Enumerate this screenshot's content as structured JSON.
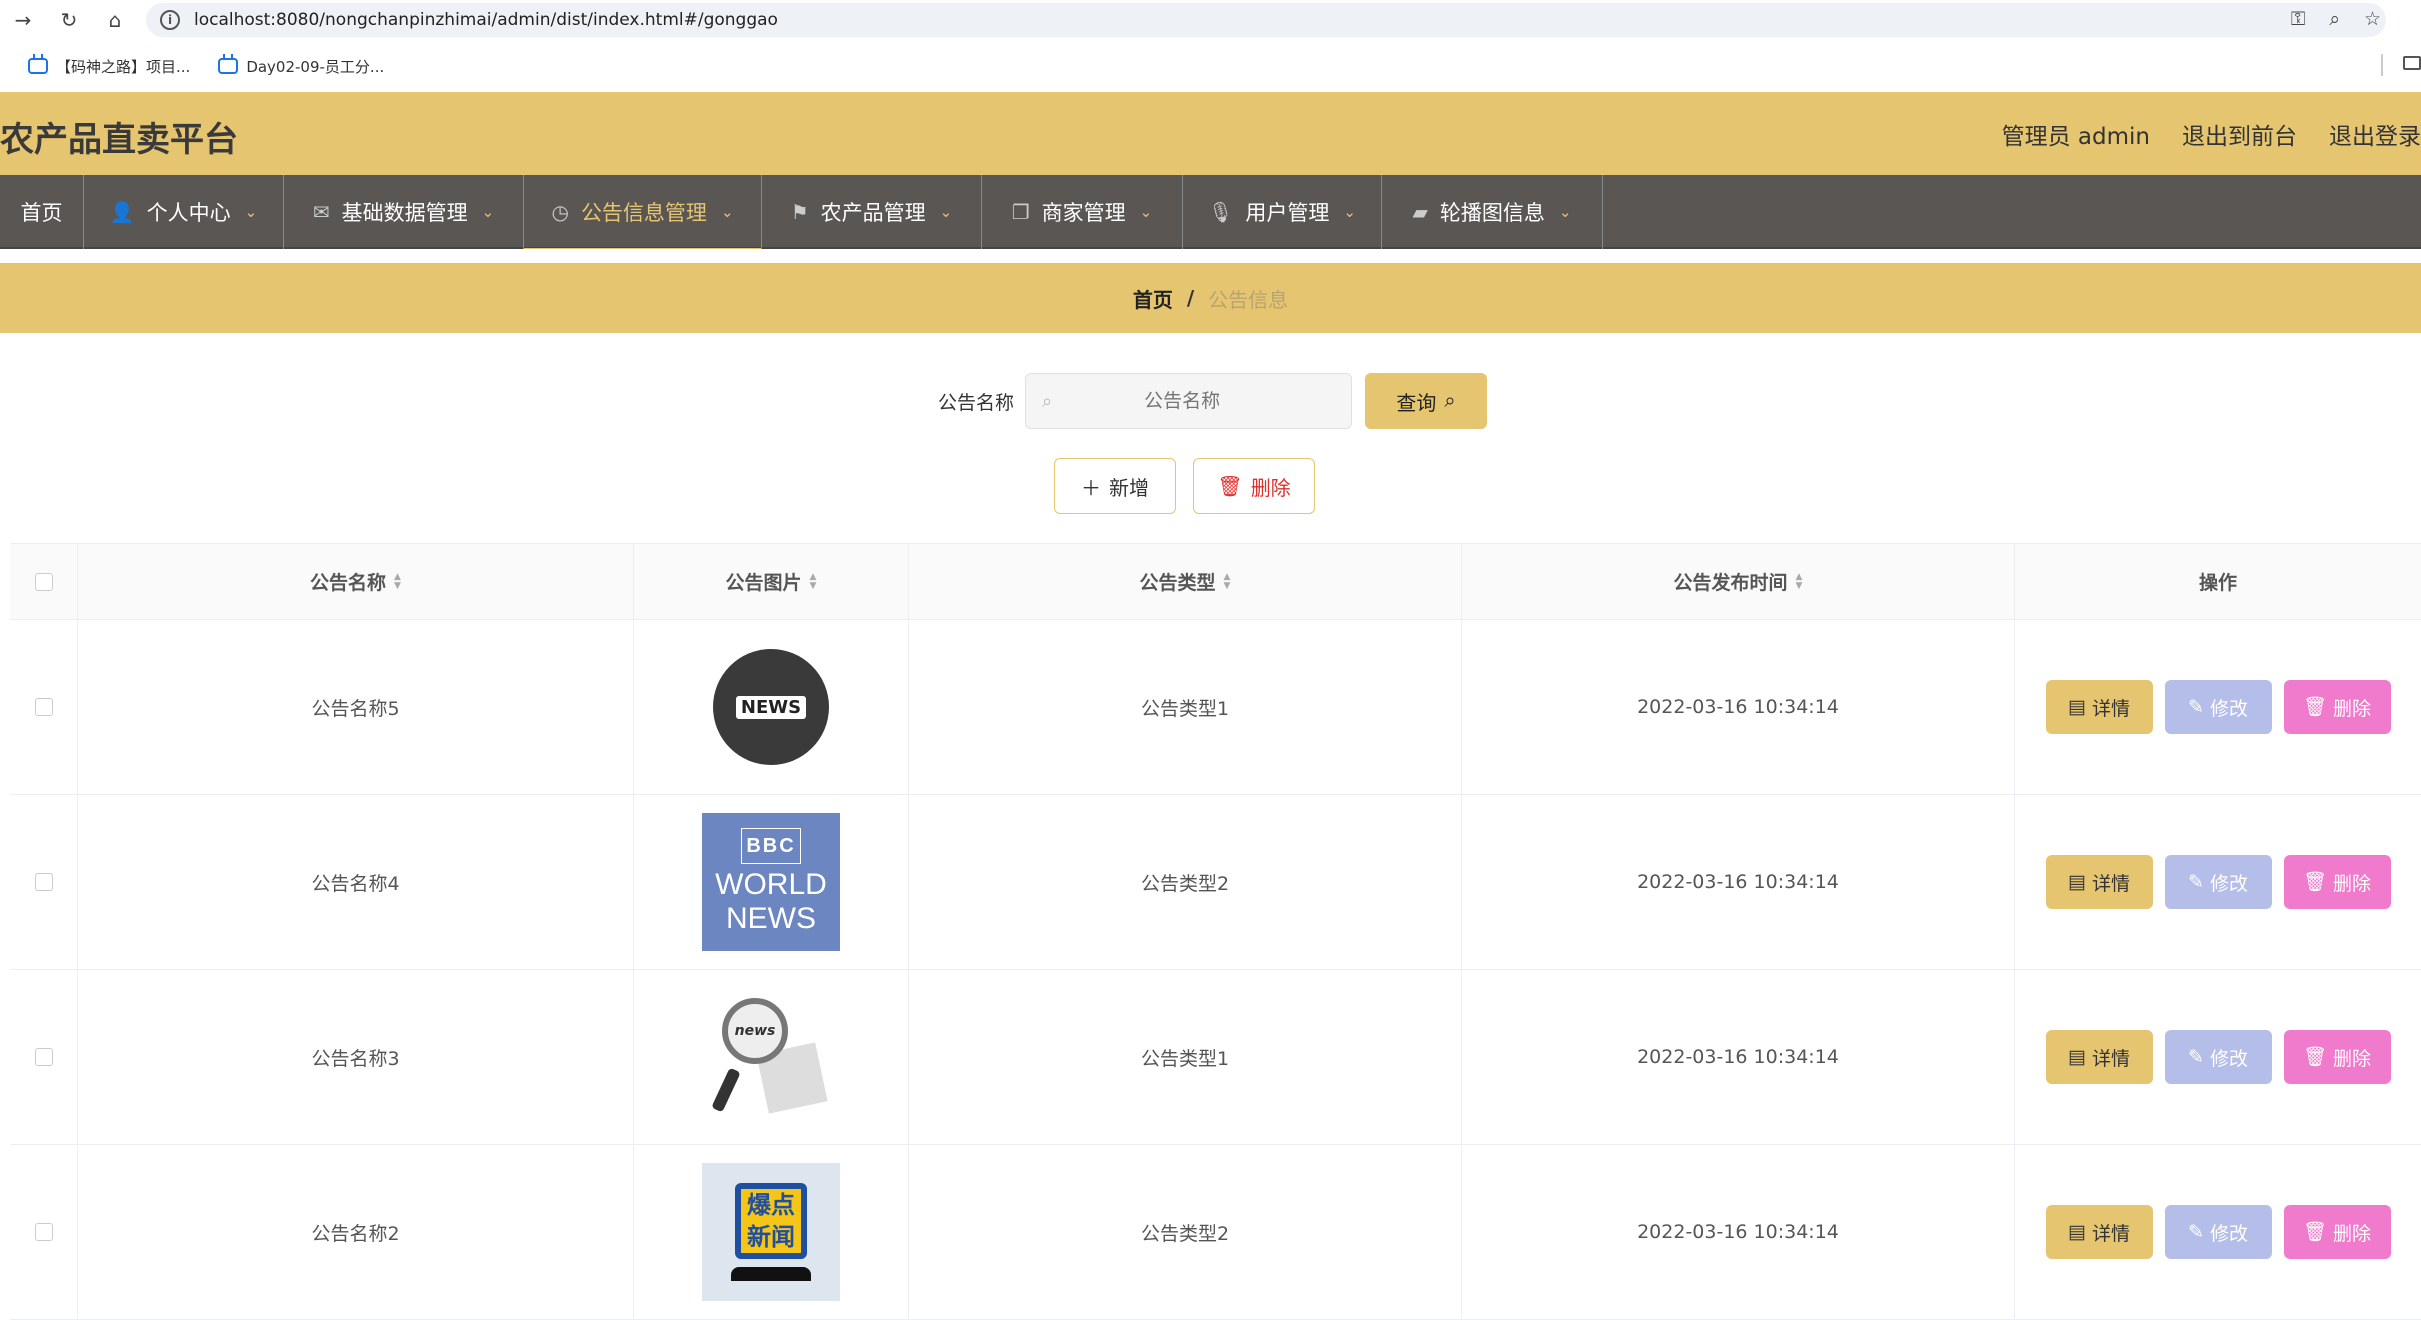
{
  "browser": {
    "url": "localhost:8080/nongchanpinzhimai/admin/dist/index.html#/gonggao",
    "bookmarks": [
      "【码神之路】项目...",
      "Day02-09-员工分..."
    ]
  },
  "header": {
    "title": "农产品直卖平台",
    "user_label": "管理员 admin",
    "to_front_label": "退出到前台",
    "logout_label": "退出登录"
  },
  "nav": {
    "items": [
      {
        "label": "首页",
        "icon": "home-icon"
      },
      {
        "label": "个人中心",
        "icon": "user-icon"
      },
      {
        "label": "基础数据管理",
        "icon": "mail-icon"
      },
      {
        "label": "公告信息管理",
        "icon": "clock-icon"
      },
      {
        "label": "农产品管理",
        "icon": "flag-icon"
      },
      {
        "label": "商家管理",
        "icon": "copy-icon"
      },
      {
        "label": "用户管理",
        "icon": "mic-icon"
      },
      {
        "label": "轮播图信息",
        "icon": "chat-icon"
      }
    ],
    "active_index": 3
  },
  "breadcrumb": {
    "home": "首页",
    "separator": "/",
    "current": "公告信息"
  },
  "search": {
    "label": "公告名称",
    "placeholder": "公告名称",
    "query_label": "查询"
  },
  "actions": {
    "add_label": "新增",
    "delete_label": "删除"
  },
  "table": {
    "columns": [
      "公告名称",
      "公告图片",
      "公告类型",
      "公告发布时间",
      "操作"
    ],
    "rows": [
      {
        "name": "公告名称5",
        "image": "news-globe",
        "type": "公告类型1",
        "time": "2022-03-16 10:34:14"
      },
      {
        "name": "公告名称4",
        "image": "bbc-world-news",
        "type": "公告类型2",
        "time": "2022-03-16 10:34:14"
      },
      {
        "name": "公告名称3",
        "image": "news-magnifier",
        "type": "公告类型1",
        "time": "2022-03-16 10:34:14"
      },
      {
        "name": "公告名称2",
        "image": "baodian-news",
        "type": "公告类型2",
        "time": "2022-03-16 10:34:14"
      }
    ],
    "op_labels": {
      "detail": "详情",
      "edit": "修改",
      "delete": "删除"
    }
  },
  "thumb_text": {
    "news": "NEWS",
    "bbc": "BBC",
    "world": "WORLD",
    "news2": "NEWS",
    "mag": "news",
    "burst1": "爆点",
    "burst2": "新闻"
  },
  "colors": {
    "accent": "#e5c570",
    "nav_bg": "#5a5654",
    "edit": "#b5bde9",
    "delete": "#f07acb"
  }
}
